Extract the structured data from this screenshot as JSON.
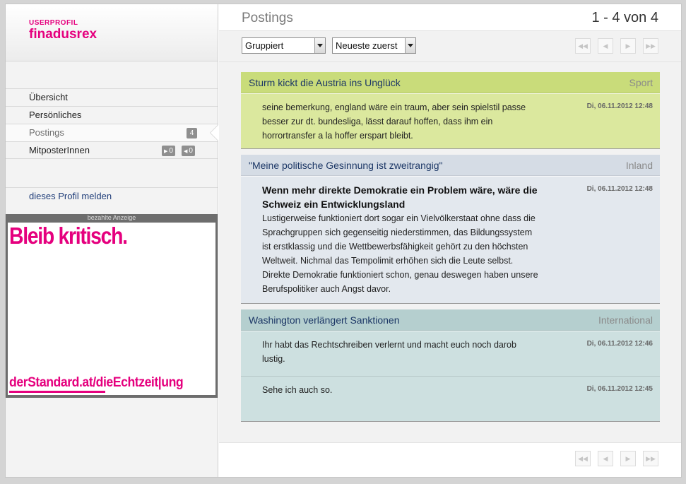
{
  "profile": {
    "kicker": "USERPROFIL",
    "name": "finadusrex"
  },
  "nav": [
    {
      "label": "Übersicht"
    },
    {
      "label": "Persönliches"
    },
    {
      "label": "Postings",
      "badge": "4"
    },
    {
      "label": "MitposterInnen",
      "badge_in": "0",
      "badge_out": "0"
    }
  ],
  "report_label": "dieses Profil melden",
  "ad": {
    "label": "bezahlte Anzeige",
    "slogan": "Bleib kritisch.",
    "url": "derStandard.at/dieEchtzeit|ung"
  },
  "main": {
    "title": "Postings",
    "count": "1 - 4 von 4",
    "filter_group": "Gruppiert",
    "filter_sort": "Neueste zuerst"
  },
  "icons": {
    "first": "double-left-icon",
    "prev": "left-icon",
    "next": "right-icon",
    "last": "double-right-icon"
  },
  "colors": {
    "brand": "#e5007e",
    "sport": "#c9dc7a",
    "inland": "#d5dce5",
    "international": "#b5cfcf"
  },
  "threads": [
    {
      "title": "Sturm kickt die Austria ins Unglück",
      "category": "Sport",
      "posts": [
        {
          "title": "",
          "text": "seine bemerkung, england wäre ein traum, aber sein spielstil passe besser zur dt. bundesliga, lässt darauf hoffen, dass ihm ein horrortransfer a la hoffer erspart bleibt.",
          "date": "Di, 06.11.2012 12:48"
        }
      ]
    },
    {
      "title": "\"Meine politische Gesinnung ist zweitrangig\"",
      "category": "Inland",
      "posts": [
        {
          "title": "Wenn mehr direkte Demokratie ein Problem wäre, wäre die Schweiz ein Entwicklungsland",
          "text": "Lustigerweise funktioniert dort sogar ein Vielvölkerstaat ohne dass die Sprachgruppen sich gegenseitig niederstimmen, das Bildungssystem ist erstklassig und die Wettbewerbsfähigkeit gehört zu den höchsten Weltweit. Nichmal das Tempolimit erhöhen sich die Leute selbst. Direkte Demokratie funktioniert schon, genau deswegen haben unsere Berufspolitiker auch Angst davor.",
          "date": "Di, 06.11.2012 12:48"
        }
      ]
    },
    {
      "title": "Washington verlängert Sanktionen",
      "category": "International",
      "posts": [
        {
          "title": "",
          "text": "Ihr habt das Rechtschreiben verlernt und macht euch noch darob lustig.",
          "date": "Di, 06.11.2012 12:46"
        },
        {
          "title": "",
          "text": "Sehe ich auch so.",
          "date": "Di, 06.11.2012 12:45"
        }
      ]
    }
  ]
}
